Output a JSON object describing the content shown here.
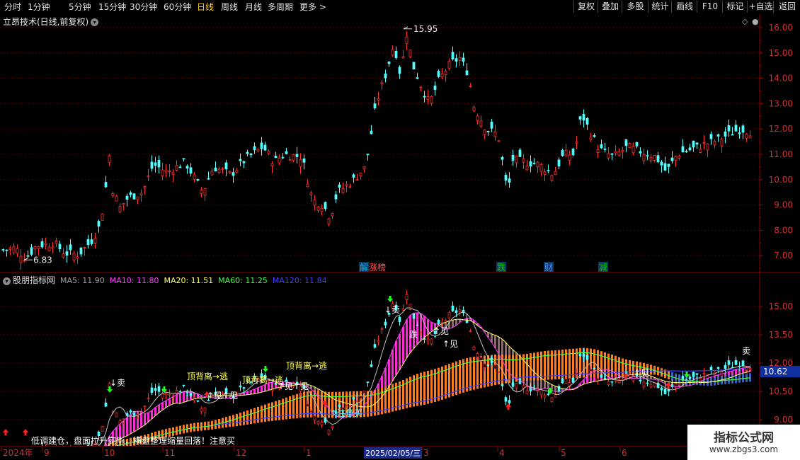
{
  "toolbar": {
    "left": [
      "分时",
      "1分钟",
      "5分钟",
      "15分钟",
      "30分钟",
      "60分钟",
      "日线",
      "周线",
      "月线",
      "多周期",
      "更多 >"
    ],
    "active_index": 6,
    "right": [
      "复权",
      "叠加",
      "多股",
      "统计",
      "画线",
      "F10",
      "标记",
      "+自选",
      "返回"
    ]
  },
  "upper": {
    "title": "立昂技术(日线,前复权)",
    "max_label": "15.95",
    "min_label": "6.83",
    "y_ticks": [
      "16.00",
      "15.00",
      "14.00",
      "13.00",
      "12.00",
      "11.00",
      "10.00",
      "9.00",
      "8.00",
      "7.00"
    ],
    "events": [
      {
        "text": "解",
        "color": "#00b0ff",
        "box": true
      },
      {
        "text": "涨榜",
        "color": "#ff6060",
        "box": false
      },
      {
        "text": "跌",
        "color": "#00d000",
        "box": true
      },
      {
        "text": "财",
        "color": "#4f8bff",
        "box": true
      },
      {
        "text": "减",
        "color": "#00d000",
        "box": true
      }
    ]
  },
  "lower": {
    "name": "股朋指标网",
    "ma": [
      {
        "label": "MA5: 11.90",
        "color": "#a0a0a0"
      },
      {
        "label": "MA10: 11.80",
        "color": "#ff40ff"
      },
      {
        "label": "MA20: 11.51",
        "color": "#ffff60"
      },
      {
        "label": "MA60: 11.25",
        "color": "#40ff40"
      },
      {
        "label": "MA120: 11.84",
        "color": "#4040ff"
      }
    ],
    "y_ticks": [
      "15.00",
      "13.50",
      "12.00",
      "10.50",
      "9.00"
    ],
    "current_price": "10.62",
    "texts": {
      "sell": "卖",
      "see": "见",
      "top_divergence": "顶背离→逃",
      "attention_buy": "注意买",
      "fall": "跌",
      "bottom_line": "低调建仓，盘面拉升完毕，横盘整理缩量回落！注意买"
    }
  },
  "x_axis": [
    "2024年",
    "9",
    "10",
    "11",
    "12",
    "1",
    "2025/02/05/三",
    "3",
    "4",
    "5",
    "6"
  ],
  "watermark": {
    "title": "指标公式网",
    "url": "www.zbgs3.com"
  }
}
